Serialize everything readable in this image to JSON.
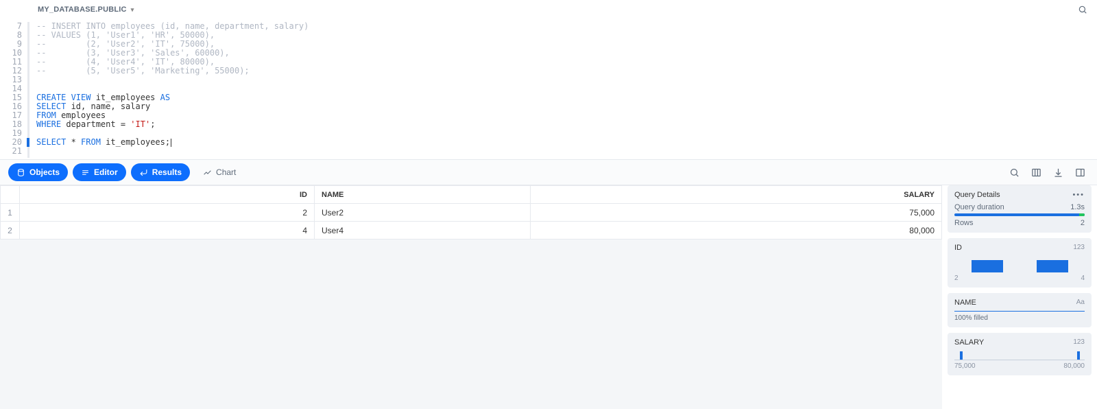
{
  "topbar": {
    "database_label": "MY_DATABASE.PUBLIC"
  },
  "editor": {
    "start_line": 7,
    "active_line": 20,
    "lines": [
      {
        "n": 7,
        "type": "comment",
        "text": "-- INSERT INTO employees (id, name, department, salary)"
      },
      {
        "n": 8,
        "type": "comment",
        "text": "-- VALUES (1, 'User1', 'HR', 50000),"
      },
      {
        "n": 9,
        "type": "comment",
        "text": "--        (2, 'User2', 'IT', 75000),"
      },
      {
        "n": 10,
        "type": "comment",
        "text": "--        (3, 'User3', 'Sales', 60000),"
      },
      {
        "n": 11,
        "type": "comment",
        "text": "--        (4, 'User4', 'IT', 80000),"
      },
      {
        "n": 12,
        "type": "comment",
        "text": "--        (5, 'User5', 'Marketing', 55000);"
      },
      {
        "n": 13,
        "type": "blank",
        "text": ""
      },
      {
        "n": 14,
        "type": "sql",
        "tokens": [
          [
            "kw",
            "CREATE VIEW"
          ],
          [
            "",
            "it_employees "
          ],
          [
            "kw",
            "AS"
          ]
        ]
      },
      {
        "n": 15,
        "type": "sql",
        "tokens": [
          [
            "kw",
            "SELECT"
          ],
          [
            "",
            " id, name, salary"
          ]
        ]
      },
      {
        "n": 16,
        "type": "sql",
        "tokens": [
          [
            "kw",
            "FROM"
          ],
          [
            "",
            " employees"
          ]
        ]
      },
      {
        "n": 17,
        "type": "sql",
        "tokens": [
          [
            "kw",
            "WHERE"
          ],
          [
            "",
            " department = "
          ],
          [
            "str",
            "'IT'"
          ],
          [
            "",
            ";"
          ]
        ]
      },
      {
        "n": 18,
        "type": "blank",
        "text": ""
      },
      {
        "n": 19,
        "type": "sql",
        "tokens": [
          [
            "kw",
            "SELECT"
          ],
          [
            "",
            " * "
          ],
          [
            "kw",
            "FROM"
          ],
          [
            "",
            " it_employees;"
          ]
        ]
      },
      {
        "n": 20,
        "type": "blank",
        "text": ""
      },
      {
        "n": 21,
        "type": "blank",
        "text": ""
      }
    ]
  },
  "toolbar": {
    "objects_label": "Objects",
    "editor_label": "Editor",
    "results_label": "Results",
    "chart_label": "Chart"
  },
  "table": {
    "columns": {
      "id": "ID",
      "name": "NAME",
      "salary": "SALARY"
    },
    "rows": [
      {
        "row": "1",
        "id": "2",
        "name": "User2",
        "salary": "75,000"
      },
      {
        "row": "2",
        "id": "4",
        "name": "User4",
        "salary": "80,000"
      }
    ]
  },
  "details": {
    "title": "Query Details",
    "duration_label": "Query duration",
    "duration_value": "1.3s",
    "rows_label": "Rows",
    "rows_value": "2",
    "id_card": {
      "title": "ID",
      "type_tag": "123",
      "tick_min": "2",
      "tick_max": "4"
    },
    "name_card": {
      "title": "NAME",
      "type_tag": "Aa",
      "fill_text": "100% filled"
    },
    "salary_card": {
      "title": "SALARY",
      "type_tag": "123",
      "tick_min": "75,000",
      "tick_max": "80,000"
    }
  },
  "chart_data": [
    {
      "type": "bar",
      "title": "ID",
      "categories": [
        "2",
        "4"
      ],
      "values": [
        1,
        1
      ],
      "xlabel": "",
      "ylabel": "",
      "ylim": [
        0,
        1
      ]
    },
    {
      "type": "bar",
      "title": "SALARY",
      "categories": [
        "75,000",
        "80,000"
      ],
      "values": [
        1,
        1
      ],
      "xlabel": "",
      "ylabel": "",
      "ylim": [
        0,
        1
      ]
    }
  ]
}
